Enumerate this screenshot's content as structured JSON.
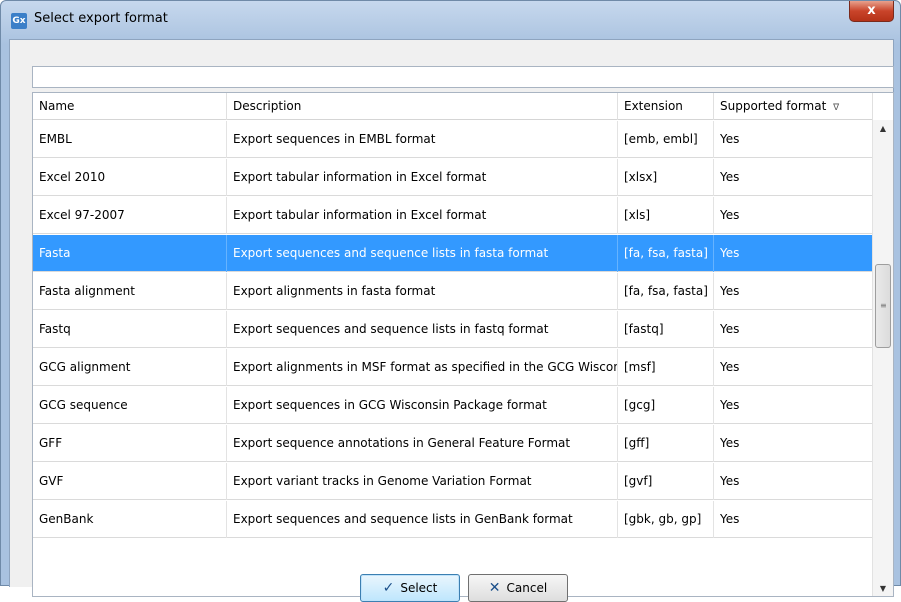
{
  "window": {
    "title": "Select export format",
    "app_icon_label": "Gx",
    "close_label": "x"
  },
  "filter": {
    "value": "",
    "placeholder": ""
  },
  "table": {
    "columns": [
      "Name",
      "Description",
      "Extension",
      "Supported format"
    ],
    "rows": [
      {
        "name": "EMBL",
        "description": "Export sequences in EMBL format",
        "extension": "[emb, embl]",
        "supported": "Yes"
      },
      {
        "name": "Excel 2010",
        "description": "Export tabular information in Excel format",
        "extension": "[xlsx]",
        "supported": "Yes"
      },
      {
        "name": "Excel 97-2007",
        "description": "Export tabular information in Excel format",
        "extension": "[xls]",
        "supported": "Yes"
      },
      {
        "name": "Fasta",
        "description": "Export sequences and sequence lists in fasta format",
        "extension": "[fa, fsa, fasta]",
        "supported": "Yes",
        "selected": true
      },
      {
        "name": "Fasta alignment",
        "description": "Export alignments in fasta format",
        "extension": "[fa, fsa, fasta]",
        "supported": "Yes"
      },
      {
        "name": "Fastq",
        "description": "Export sequences and sequence lists in fastq format",
        "extension": "[fastq]",
        "supported": "Yes"
      },
      {
        "name": "GCG alignment",
        "description": "Export alignments in MSF format as specified in the GCG Wiscon...",
        "extension": "[msf]",
        "supported": "Yes"
      },
      {
        "name": "GCG sequence",
        "description": "Export sequences in GCG Wisconsin Package format",
        "extension": "[gcg]",
        "supported": "Yes"
      },
      {
        "name": "GFF",
        "description": "Export sequence annotations in General Feature Format",
        "extension": "[gff]",
        "supported": "Yes"
      },
      {
        "name": "GVF",
        "description": "Export variant tracks in Genome Variation Format",
        "extension": "[gvf]",
        "supported": "Yes"
      },
      {
        "name": "GenBank",
        "description": "Export sequences and sequence lists in GenBank format",
        "extension": "[gbk, gb, gp]",
        "supported": "Yes"
      }
    ],
    "selected_color": "#3399ff"
  },
  "buttons": {
    "select_label": "Select",
    "cancel_label": "Cancel"
  },
  "icons": {
    "check": "check-icon",
    "cancel": "x-icon",
    "sort": "sort-descending-icon"
  }
}
